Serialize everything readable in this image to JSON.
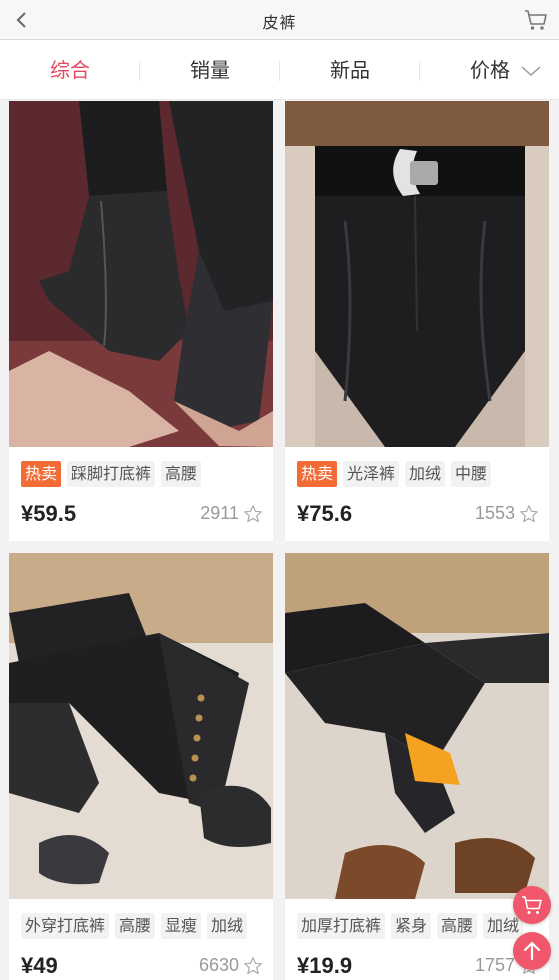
{
  "header": {
    "title": "皮裤",
    "back_icon": "chevron-left-icon",
    "cart_icon": "shopping-cart-icon"
  },
  "sort_tabs": [
    {
      "label": "综合",
      "active": true
    },
    {
      "label": "销量",
      "active": false
    },
    {
      "label": "新品",
      "active": false
    },
    {
      "label": "价格",
      "active": false,
      "icon": "chevron-down-icon"
    }
  ],
  "colors": {
    "accent": "#e4475e",
    "hot_tag": "#f36c36",
    "fab": "#f0576c"
  },
  "products": [
    {
      "tags": [
        {
          "text": "热卖",
          "hot": true
        },
        {
          "text": "踩脚打底裤"
        },
        {
          "text": "高腰"
        }
      ],
      "price": "¥59.5",
      "sales": "2911"
    },
    {
      "tags": [
        {
          "text": "热卖",
          "hot": true
        },
        {
          "text": "光泽裤"
        },
        {
          "text": "加绒"
        },
        {
          "text": "中腰"
        }
      ],
      "price": "¥75.6",
      "sales": "1553"
    },
    {
      "tags": [
        {
          "text": "外穿打底裤"
        },
        {
          "text": "高腰"
        },
        {
          "text": "显瘦"
        },
        {
          "text": "加绒"
        }
      ],
      "price": "¥49",
      "sales": "6630"
    },
    {
      "tags": [
        {
          "text": "加厚打底裤"
        },
        {
          "text": "紧身"
        },
        {
          "text": "高腰"
        },
        {
          "text": "加绒"
        }
      ],
      "price": "¥19.9",
      "sales": "1757"
    }
  ],
  "floating_buttons": {
    "cart_icon": "shopping-cart-icon",
    "top_icon": "arrow-up-icon"
  }
}
